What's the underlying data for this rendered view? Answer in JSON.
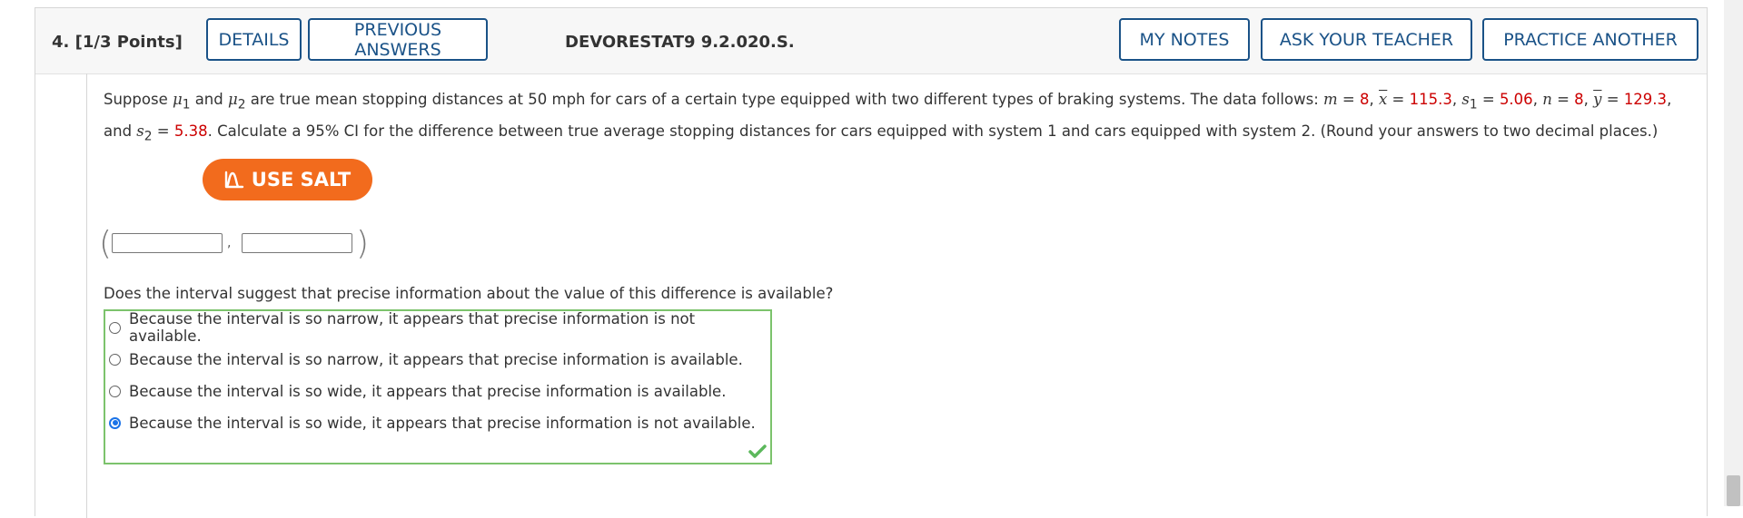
{
  "question": {
    "number_label": "4.  [1/3 Points]",
    "assignment_code": "DEVORESTAT9 9.2.020.S."
  },
  "header_buttons": {
    "details": "DETAILS",
    "previous_answers": "PREVIOUS ANSWERS",
    "my_notes": "MY NOTES",
    "ask_teacher": "ASK YOUR TEACHER",
    "practice_another": "PRACTICE ANOTHER"
  },
  "prompt": {
    "p1": "Suppose ",
    "mu": "μ",
    "sub1": "1",
    "p2": " and ",
    "sub2": "2",
    "p3": " are true mean stopping distances at 50 mph for cars of a certain type equipped with two different types of braking systems. The data follows: ",
    "m": "m",
    "eq": " = ",
    "m_val": "8",
    "comma": ", ",
    "x": "x",
    "x_val": "115.3",
    "s": "s",
    "s1_val": "5.06",
    "n": "n",
    "n_val": "8",
    "y": "y",
    "y_val": "129.3",
    "p4": ", and ",
    "s2_val": "5.38",
    "p5": ". Calculate a 95% CI for the difference between true average stopping distances for cars equipped with system 1 and cars equipped with system 2. (Round your answers to two decimal places.)"
  },
  "salt_button": {
    "label": "USE SALT"
  },
  "ci": {
    "open_paren": "(",
    "separator": ",",
    "close_paren": ")",
    "lower_value": "",
    "upper_value": ""
  },
  "mc": {
    "question": "Does the interval suggest that precise information about the value of this difference is available?",
    "options": [
      {
        "label": "Because the interval is so narrow, it appears that precise information is not available.",
        "selected": false
      },
      {
        "label": "Because the interval is so narrow, it appears that precise information is available.",
        "selected": false
      },
      {
        "label": "Because the interval is so wide, it appears that precise information is available.",
        "selected": false
      },
      {
        "label": "Because the interval is so wide, it appears that precise information is not available.",
        "selected": true
      }
    ],
    "status": "correct"
  },
  "colors": {
    "accent_blue": "#1a5287",
    "given_red": "#cc0000",
    "salt_orange": "#f26b1d",
    "correct_green": "#7cc36c"
  },
  "icons": {
    "salt": "salt-icon",
    "correct": "checkmark-icon",
    "radio": "radio-icon"
  }
}
